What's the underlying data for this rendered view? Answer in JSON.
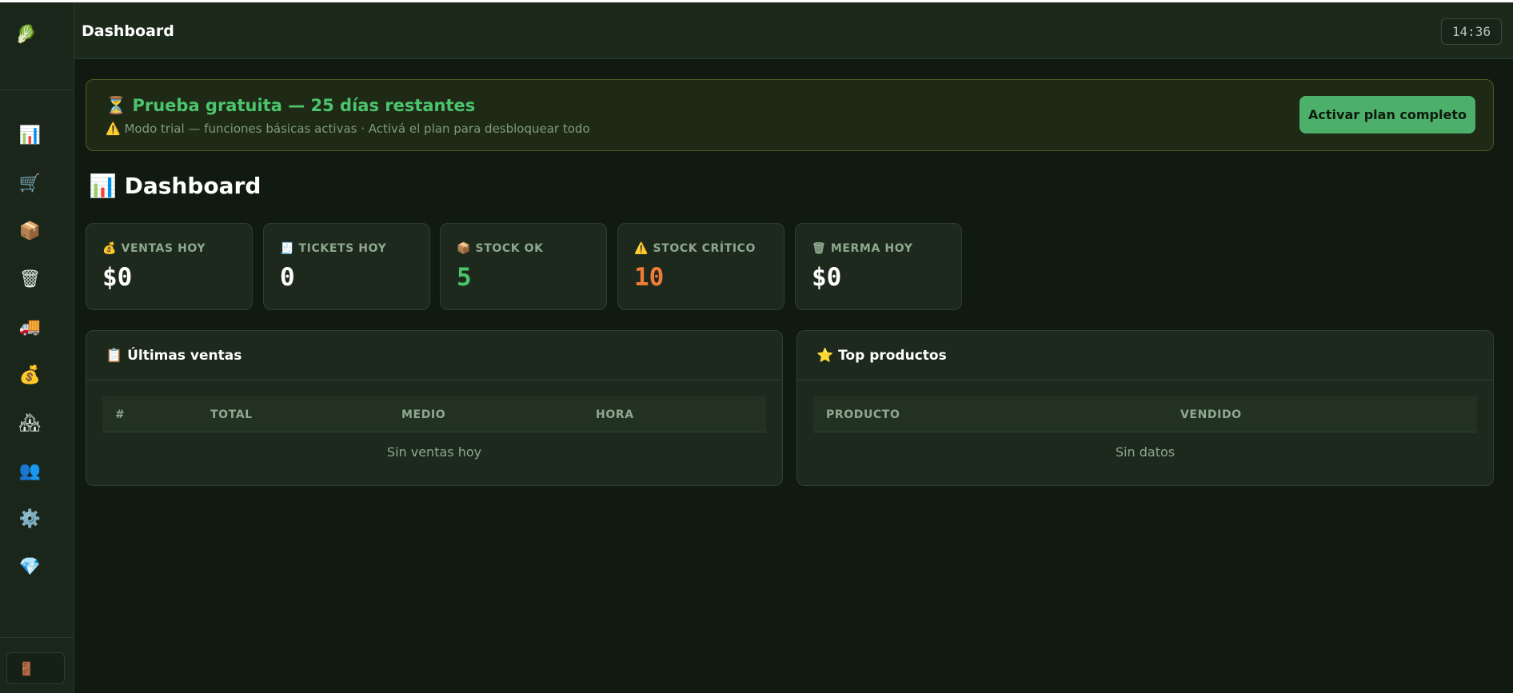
{
  "sidebar": {
    "logo_icon": "🥬",
    "items": [
      {
        "icon": "📊",
        "name": "chart-icon"
      },
      {
        "icon": "🛒",
        "name": "cart-icon"
      },
      {
        "icon": "📦",
        "name": "package-icon"
      },
      {
        "icon": "🗑",
        "name": "trash-icon"
      },
      {
        "icon": "🚚",
        "name": "truck-icon"
      },
      {
        "icon": "💰",
        "name": "money-bag-icon"
      },
      {
        "icon": "🏘",
        "name": "houses-icon"
      },
      {
        "icon": "👥",
        "name": "users-icon"
      },
      {
        "icon": "⚙️",
        "name": "gear-icon"
      },
      {
        "icon": "💎",
        "name": "gem-icon"
      }
    ],
    "logout_icon": "🚪"
  },
  "header": {
    "title": "Dashboard",
    "clock": "14:36"
  },
  "banner": {
    "icon": "⏳",
    "title": "Prueba gratuita — 25 días restantes",
    "warn_icon": "⚠️",
    "subtitle": "Modo trial — funciones básicas activas · Activá el plan para desbloquear todo",
    "button": "Activar plan completo"
  },
  "page": {
    "icon": "📊",
    "title": "Dashboard"
  },
  "stats": [
    {
      "icon": "💰",
      "label": "VENTAS HOY",
      "value": "$0",
      "color": "#ffffff"
    },
    {
      "icon": "🧾",
      "label": "TICKETS HOY",
      "value": "0",
      "color": "#ffffff"
    },
    {
      "icon": "📦",
      "label": "STOCK OK",
      "value": "5",
      "color": "#4cc46c"
    },
    {
      "icon": "⚠️",
      "label": "STOCK CRÍTICO",
      "value": "10",
      "color": "#f07a3a"
    },
    {
      "icon": "🗑",
      "label": "MERMA HOY",
      "value": "$0",
      "color": "#ffffff"
    }
  ],
  "sales_panel": {
    "icon": "📋",
    "title": "Últimas ventas",
    "columns": [
      "#",
      "TOTAL",
      "MEDIO",
      "HORA"
    ],
    "empty": "Sin ventas hoy"
  },
  "top_panel": {
    "icon": "⭐",
    "title": "Top productos",
    "columns": [
      "PRODUCTO",
      "VENDIDO"
    ],
    "empty": "Sin datos"
  }
}
